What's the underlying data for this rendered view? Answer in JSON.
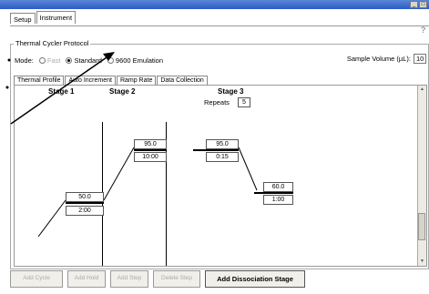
{
  "window": {
    "controls": [
      "_",
      "□"
    ]
  },
  "top_tabs": [
    {
      "label": "Setup"
    },
    {
      "label": "Instrument"
    }
  ],
  "help_glyph": "?",
  "protocol": {
    "title": "Thermal Cycler Protocol",
    "mode_label": "Mode:",
    "modes": [
      {
        "label": "Fast",
        "selected": false,
        "disabled": true
      },
      {
        "label": "Standard",
        "selected": true
      },
      {
        "label": "9600 Emulation",
        "selected": false
      }
    ],
    "sample_volume_label": "Sample Volume (µL):",
    "sample_volume_value": "10"
  },
  "sub_tabs": [
    {
      "label": "Thermal Profile"
    },
    {
      "label": "Auto Increment"
    },
    {
      "label": "Ramp Rate"
    },
    {
      "label": "Data Collection"
    }
  ],
  "stages": [
    {
      "label": "Stage 1",
      "steps": [
        {
          "temp": "50.0",
          "time": "2:00"
        }
      ]
    },
    {
      "label": "Stage 2",
      "steps": [
        {
          "temp": "95.0",
          "time": "10:00"
        }
      ]
    },
    {
      "label": "Stage 3",
      "repeats_label": "Repeats",
      "repeats_value": "5",
      "steps": [
        {
          "temp": "95.0",
          "time": "0:15"
        },
        {
          "temp": "60.0",
          "time": "1:00"
        }
      ]
    }
  ],
  "buttons": [
    {
      "label": "Add Cycle",
      "enabled": false
    },
    {
      "label": "Add Hold",
      "enabled": false
    },
    {
      "label": "Add Step",
      "enabled": false
    },
    {
      "label": "Delete Step",
      "enabled": false
    },
    {
      "label": "Add Dissociation Stage",
      "enabled": true
    }
  ],
  "colors": {
    "titlebar": "#2a5cc6",
    "panel_border": "#999999"
  }
}
